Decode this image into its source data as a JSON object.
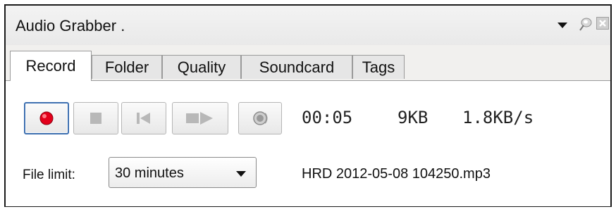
{
  "window": {
    "title": "Audio Grabber ."
  },
  "tabs": [
    {
      "label": "Record",
      "active": true
    },
    {
      "label": "Folder",
      "active": false
    },
    {
      "label": "Quality",
      "active": false
    },
    {
      "label": "Soundcard",
      "active": false
    },
    {
      "label": "Tags",
      "active": false
    }
  ],
  "controls": {
    "record_icon": "record-icon",
    "stop_icon": "stop-icon",
    "previous_icon": "skip-previous-icon",
    "play_icon": "play-icon",
    "sound_icon": "speaker-icon",
    "record_color": "#e3001b"
  },
  "status": {
    "elapsed": "00:05",
    "size": "9KB",
    "rate": "1.8KB/s"
  },
  "file_limit": {
    "label": "File limit:",
    "selected": "30 minutes"
  },
  "filename": "HRD 2012-05-08 104250.mp3"
}
